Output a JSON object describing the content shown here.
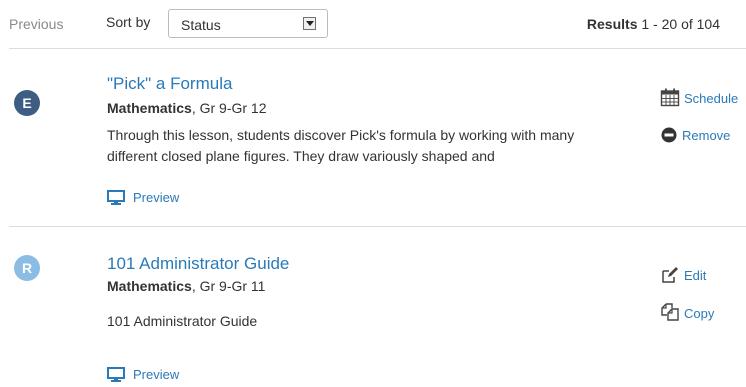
{
  "toolbar": {
    "previous_label": "Previous",
    "sort_label": "Sort by",
    "sort_value": "Status",
    "results_label": "Results",
    "results_range": " 1 - 20 of 104"
  },
  "items": [
    {
      "avatar_letter": "E",
      "avatar_color": "#3d5d82",
      "title": "\"Pick\" a Formula",
      "subject": "Mathematics",
      "grades": ", Gr 9-Gr 12",
      "description": "Through this lesson, students discover Pick's formula by working with many different closed plane figures. They draw variously shaped and",
      "preview_label": "Preview",
      "actions": [
        {
          "label": "Schedule",
          "icon": "calendar-icon"
        },
        {
          "label": "Remove",
          "icon": "minus-circle-icon"
        }
      ]
    },
    {
      "avatar_letter": "R",
      "avatar_color": "#8bbde4",
      "title": "101 Administrator Guide",
      "subject": "Mathematics",
      "grades": ", Gr 9-Gr 11",
      "description": "101 Administrator Guide",
      "preview_label": "Preview",
      "actions": [
        {
          "label": "Edit",
          "icon": "edit-icon"
        },
        {
          "label": "Copy",
          "icon": "copy-icon"
        }
      ]
    }
  ],
  "colors": {
    "link": "#2a7ab8",
    "muted": "#8a8a8a",
    "divider": "#dddddd"
  }
}
